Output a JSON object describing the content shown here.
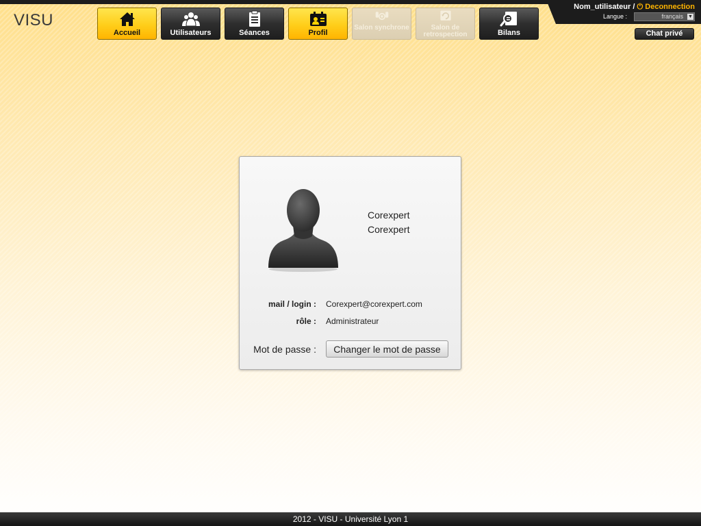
{
  "app": {
    "logo": "VISU"
  },
  "nav": [
    {
      "label": "Accueil",
      "icon": "home-icon",
      "state": "active"
    },
    {
      "label": "Utilisateurs",
      "icon": "users-icon",
      "state": "normal"
    },
    {
      "label": "Séances",
      "icon": "clipboard-icon",
      "state": "normal"
    },
    {
      "label": "Profil",
      "icon": "id-card-icon",
      "state": "active"
    },
    {
      "label": "Salon synchrone",
      "icon": "sync-room-icon",
      "state": "disabled"
    },
    {
      "label": "Salon de retrospection",
      "icon": "retrospection-icon",
      "state": "disabled"
    },
    {
      "label": "Bilans",
      "icon": "report-search-icon",
      "state": "normal"
    }
  ],
  "user": {
    "username": "Nom_utilisateur",
    "separator": "/",
    "logout_icon": "⏻",
    "logout_label": "Deconnection",
    "language_label": "Langue :",
    "language_value": "français",
    "language_arrow": "▼",
    "chat_label": "Chat privé"
  },
  "profile": {
    "first_name": "Corexpert",
    "last_name": "Corexpert",
    "mail_label": "mail / login :",
    "mail_value": "Corexpert@corexpert.com",
    "role_label": "rôle :",
    "role_value": "Administrateur",
    "password_label": "Mot de passe :",
    "password_button": "Changer le mot de passe"
  },
  "footer": {
    "text": "2012 - VISU - Université Lyon 1"
  },
  "colors": {
    "accent": "#ffc800",
    "dark": "#1c1c1c",
    "logout": "#ffb400"
  }
}
